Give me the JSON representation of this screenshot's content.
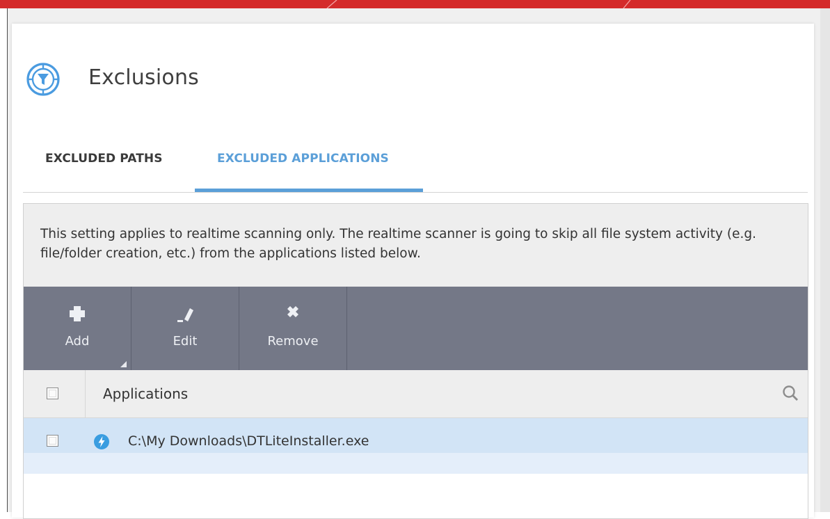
{
  "header": {
    "title": "Exclusions",
    "icon": "exclusions-filter-icon"
  },
  "tabs": [
    {
      "label": "EXCLUDED PATHS",
      "active": false
    },
    {
      "label": "EXCLUDED APPLICATIONS",
      "active": true
    }
  ],
  "info": {
    "text": "This setting applies to realtime scanning only. The realtime scanner is going to skip all file system activity (e.g. file/folder creation, etc.) from the applications listed below."
  },
  "toolbar": {
    "add_label": "Add",
    "edit_label": "Edit",
    "remove_label": "Remove"
  },
  "table": {
    "column_header": "Applications",
    "rows": [
      {
        "path": "C:\\My Downloads\\DTLiteInstaller.exe",
        "icon": "daemon-tools-icon",
        "checked": false
      }
    ]
  },
  "colors": {
    "accent": "#5b9fd8",
    "brand_red": "#d42b2b",
    "toolbar_bg": "#747887",
    "row_selected": "#d2e4f6"
  }
}
